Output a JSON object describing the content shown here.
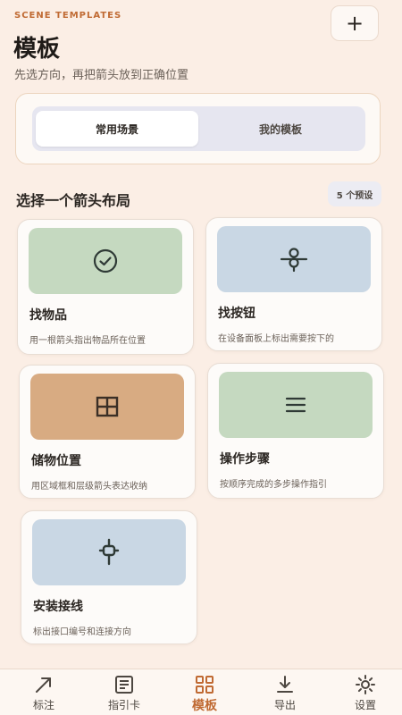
{
  "header": {
    "eyebrow": "SCENE TEMPLATES",
    "title": "模板",
    "subtitle": "先选方向，再把箭头放到正确位置",
    "add_label": "+"
  },
  "segmented": {
    "options": [
      "常用场景",
      "我的模板"
    ],
    "selected": "常用场景"
  },
  "section": {
    "title": "选择一个箭头布局",
    "badge": "5 个预设"
  },
  "templates": [
    {
      "title": "找物品",
      "desc": "用一根箭头指出物品所在位置",
      "icon": "check-circle-icon",
      "color": "#c5d9c0"
    },
    {
      "title": "找按钮",
      "desc": "在设备面板上标出需要按下的",
      "icon": "pin-target-icon",
      "color": "#c9d7e4"
    },
    {
      "title": "储物位置",
      "desc": "用区域框和层级箭头表达收纳",
      "icon": "grid-icon",
      "color": "#d8ab82"
    },
    {
      "title": "操作步骤",
      "desc": "按顺序完成的多步操作指引",
      "icon": "list-icon",
      "color": "#c5d9c0"
    },
    {
      "title": "安装接线",
      "desc": "标出接口编号和连接方向",
      "icon": "plug-icon",
      "color": "#c9d7e4"
    }
  ],
  "nav": {
    "items": [
      {
        "label": "标注",
        "icon": "arrow-icon"
      },
      {
        "label": "指引卡",
        "icon": "card-icon"
      },
      {
        "label": "模板",
        "icon": "template-icon"
      },
      {
        "label": "导出",
        "icon": "download-icon"
      },
      {
        "label": "设置",
        "icon": "settings-icon"
      }
    ],
    "active": "模板"
  },
  "colors": {
    "accent": "#c06a33",
    "background": "#fbeee5"
  }
}
